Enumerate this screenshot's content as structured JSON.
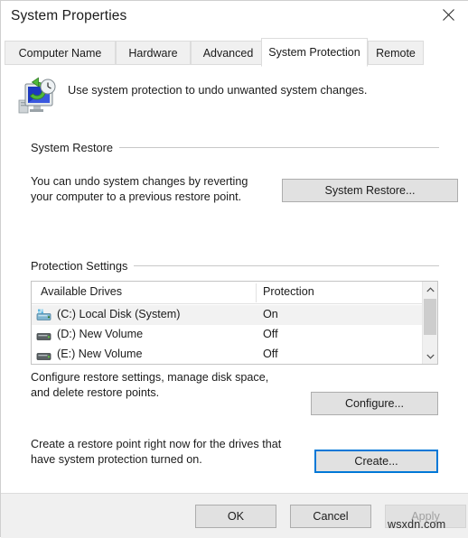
{
  "window": {
    "title": "System Properties",
    "close_icon": "close-icon"
  },
  "tabs": [
    {
      "label": "Computer Name",
      "selected": false
    },
    {
      "label": "Hardware",
      "selected": false
    },
    {
      "label": "Advanced",
      "selected": false
    },
    {
      "label": "System Protection",
      "selected": true
    },
    {
      "label": "Remote",
      "selected": false
    }
  ],
  "header": {
    "icon": "system-protection-icon",
    "description": "Use system protection to undo unwanted system changes."
  },
  "system_restore": {
    "group_label": "System Restore",
    "description_line1": "You can undo system changes by reverting",
    "description_line2": "your computer to a previous restore point.",
    "button_label": "System Restore..."
  },
  "protection_settings": {
    "group_label": "Protection Settings",
    "columns": [
      "Available Drives",
      "Protection"
    ],
    "rows": [
      {
        "drive": "(C:) Local Disk (System)",
        "protection": "On",
        "selected": true,
        "icon": "system-drive-icon"
      },
      {
        "drive": "(D:) New Volume",
        "protection": "Off",
        "selected": false,
        "icon": "drive-icon"
      },
      {
        "drive": "(E:) New Volume",
        "protection": "Off",
        "selected": false,
        "icon": "drive-icon"
      }
    ],
    "scrollbar": {
      "up_icon": "chevron-up-icon",
      "down_icon": "chevron-down-icon"
    },
    "configure": {
      "description_line1": "Configure restore settings, manage disk space,",
      "description_line2": "and delete restore points.",
      "button_label": "Configure..."
    },
    "create": {
      "description_line1": "Create a restore point right now for the drives that",
      "description_line2": "have system protection turned on.",
      "button_label": "Create...",
      "focused": true
    }
  },
  "footer": {
    "ok_label": "OK",
    "cancel_label": "Cancel",
    "apply_label": "Apply",
    "apply_disabled": true
  },
  "watermark": {
    "text": "wsxdn.com"
  },
  "colors": {
    "accent": "#0078d7",
    "dialog_bg": "#f0f0f0",
    "page_bg": "#ffffff",
    "button_bg": "#e1e1e1",
    "selected_row": "#f2f2f2"
  }
}
